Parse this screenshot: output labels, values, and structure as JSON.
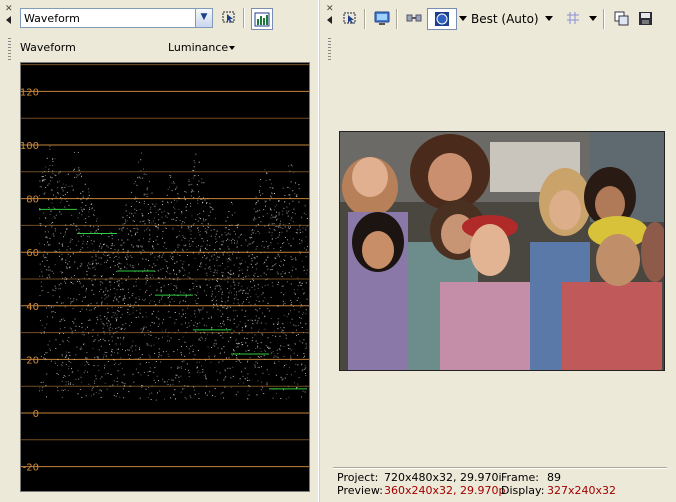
{
  "left_panel": {
    "scope_type": "Waveform",
    "title": "Waveform",
    "channel": "Luminance",
    "y_axis_labels": [
      "120",
      "100",
      "80",
      "60",
      "40",
      "20",
      "0",
      "-20"
    ]
  },
  "right_panel": {
    "preview_quality": "Best (Auto)"
  },
  "status": {
    "project_label": "Project:",
    "project_value": "720x480x32, 29.970i",
    "frame_label": "Frame:",
    "frame_value": "89",
    "preview_label": "Preview:",
    "preview_value": "360x240x32, 29.970p",
    "display_label": "Display:",
    "display_value": "327x240x32"
  },
  "colors": {
    "scope_background": "#000000",
    "graticule": "#d08a3a",
    "trace": "#d8d8d8",
    "marker": "#2ecc40",
    "status_highlight": "#a00000",
    "panel_background": "#ece9d8"
  },
  "icons": {
    "close": "close-icon",
    "collapse": "collapse-arrow-icon",
    "selection_tool": "selection-tool-icon",
    "histogram_toggle": "histogram-icon",
    "external_monitor": "monitor-icon",
    "split_screen": "split-screen-icon",
    "overlay": "overlay-icon",
    "grid": "grid-icon",
    "copy_snapshot": "copy-snapshot-icon",
    "save_snapshot": "save-snapshot-icon"
  }
}
